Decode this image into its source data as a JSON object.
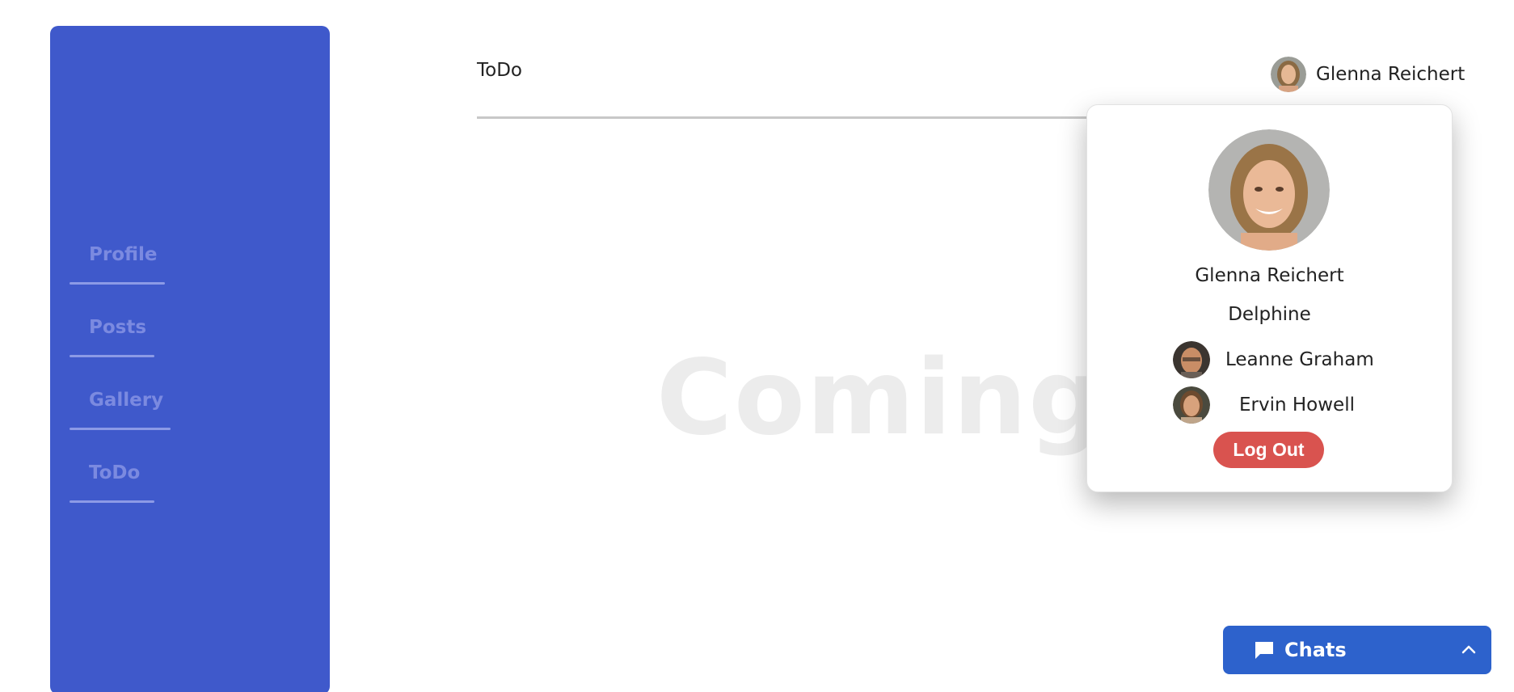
{
  "sidebar": {
    "items": [
      {
        "label": "Profile"
      },
      {
        "label": "Posts"
      },
      {
        "label": "Gallery"
      },
      {
        "label": "ToDo"
      }
    ]
  },
  "header": {
    "title": "ToDo",
    "user_name": "Glenna Reichert"
  },
  "main": {
    "coming_soon": "Coming Soon"
  },
  "popup": {
    "name": "Glenna Reichert",
    "username": "Delphine",
    "friends": [
      {
        "name": "Leanne Graham",
        "avatar_icon": "avatar-icon"
      },
      {
        "name": "Ervin Howell",
        "avatar_icon": "avatar-icon"
      }
    ],
    "logout_label": "Log Out"
  },
  "chats": {
    "label": "Chats",
    "icon": "chat-icon",
    "toggle_icon": "chevron-up-icon"
  },
  "colors": {
    "sidebar": "#3f59cb",
    "logout": "#d9534f",
    "chats": "#2d62cc"
  }
}
